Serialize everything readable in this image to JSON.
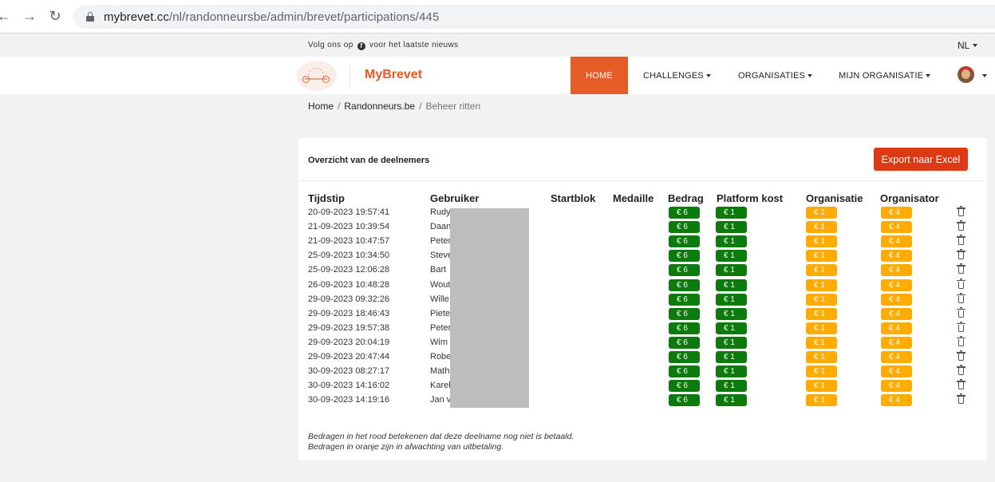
{
  "browser": {
    "url_domain": "mybrevet.cc",
    "url_path": "/nl/randonneursbe/admin/brevet/participations/445"
  },
  "topinfo": {
    "follow_before": "Volg ons op",
    "follow_after": "voor het laatste nieuws",
    "fb_glyph": "f",
    "language": "NL"
  },
  "navbar": {
    "brand": "MyBrevet",
    "home": "HOME",
    "challenges": "CHALLENGES",
    "organisaties": "ORGANISATIES",
    "mijn_organisatie": "MIJN ORGANISATIE"
  },
  "breadcrumb": {
    "home": "Home",
    "club": "Randonneurs.be",
    "current": "Beheer ritten",
    "sep": "/"
  },
  "card": {
    "title": "Overzicht van de deelnemers",
    "export_label": "Export naar Excel"
  },
  "table": {
    "headers": {
      "tijdstip": "Tijdstip",
      "gebruiker": "Gebruiker",
      "startblok": "Startblok",
      "medaille": "Medaille",
      "bedrag": "Bedrag",
      "platform": "Platform kost",
      "organisatie": "Organisatie",
      "organisator": "Organisator"
    },
    "rows": [
      {
        "tijdstip": "20-09-2023 19:57:41",
        "gebruiker": "Rudy",
        "bedrag": "€ 6",
        "platform": "€ 1",
        "organisatie": "€ 1",
        "organisator": "€ 4"
      },
      {
        "tijdstip": "21-09-2023 10:39:54",
        "gebruiker": "Daan",
        "bedrag": "€ 6",
        "platform": "€ 1",
        "organisatie": "€ 1",
        "organisator": "€ 4"
      },
      {
        "tijdstip": "21-09-2023 10:47:57",
        "gebruiker": "Peter",
        "bedrag": "€ 6",
        "platform": "€ 1",
        "organisatie": "€ 1",
        "organisator": "€ 4"
      },
      {
        "tijdstip": "25-09-2023 10:34:50",
        "gebruiker": "Steve",
        "bedrag": "€ 6",
        "platform": "€ 1",
        "organisatie": "€ 1",
        "organisator": "€ 4"
      },
      {
        "tijdstip": "25-09-2023 12:06:28",
        "gebruiker": "Bart",
        "bedrag": "€ 6",
        "platform": "€ 1",
        "organisatie": "€ 1",
        "organisator": "€ 4"
      },
      {
        "tijdstip": "26-09-2023 10:48:28",
        "gebruiker": "Wout",
        "bedrag": "€ 6",
        "platform": "€ 1",
        "organisatie": "€ 1",
        "organisator": "€ 4"
      },
      {
        "tijdstip": "29-09-2023 09:32:26",
        "gebruiker": "Wille",
        "bedrag": "€ 6",
        "platform": "€ 1",
        "organisatie": "€ 1",
        "organisator": "€ 4"
      },
      {
        "tijdstip": "29-09-2023 18:46:43",
        "gebruiker": "Piete",
        "bedrag": "€ 6",
        "platform": "€ 1",
        "organisatie": "€ 1",
        "organisator": "€ 4"
      },
      {
        "tijdstip": "29-09-2023 19:57:38",
        "gebruiker": "Peter",
        "bedrag": "€ 6",
        "platform": "€ 1",
        "organisatie": "€ 1",
        "organisator": "€ 4"
      },
      {
        "tijdstip": "29-09-2023 20:04:19",
        "gebruiker": "Wim",
        "bedrag": "€ 6",
        "platform": "€ 1",
        "organisatie": "€ 1",
        "organisator": "€ 4"
      },
      {
        "tijdstip": "29-09-2023 20:47:44",
        "gebruiker": "Robe",
        "bedrag": "€ 6",
        "platform": "€ 1",
        "organisatie": "€ 1",
        "organisator": "€ 4"
      },
      {
        "tijdstip": "30-09-2023 08:27:17",
        "gebruiker": "Math",
        "bedrag": "€ 6",
        "platform": "€ 1",
        "organisatie": "€ 1",
        "organisator": "€ 4"
      },
      {
        "tijdstip": "30-09-2023 14:16:02",
        "gebruiker": "Karel",
        "bedrag": "€ 6",
        "platform": "€ 1",
        "organisatie": "€ 1",
        "organisator": "€ 4"
      },
      {
        "tijdstip": "30-09-2023 14:19:16",
        "gebruiker": "Jan v",
        "bedrag": "€ 6",
        "platform": "€ 1",
        "organisatie": "€ 1",
        "organisator": "€ 4"
      }
    ]
  },
  "notes": {
    "line1": "Bedragen in het rood betekenen dat deze deelname nog niet is betaald.",
    "line2": "Bedragen in oranje zijn in afwachting van uitbetaling."
  },
  "colors": {
    "brand": "#e35a24",
    "home_active": "#e55c26",
    "export_button": "#dc3a14",
    "badge_paid": "#0c7a0c",
    "badge_pending": "#ffab00"
  },
  "icons": [
    "back-arrow-icon",
    "forward-arrow-icon",
    "reload-icon",
    "lock-icon",
    "facebook-icon",
    "logo-icon",
    "avatar-icon",
    "trash-icon"
  ]
}
